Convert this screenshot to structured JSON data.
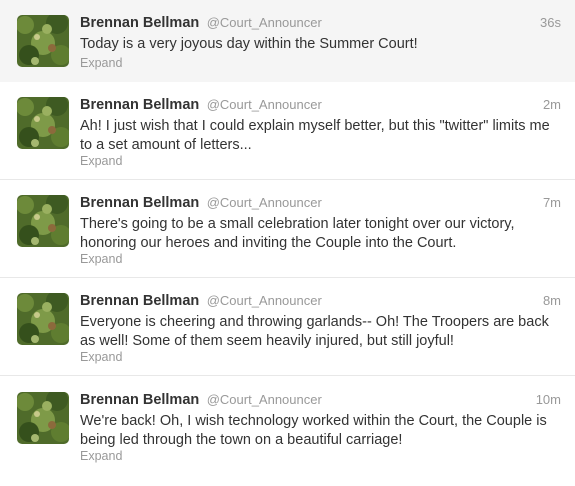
{
  "tweets": [
    {
      "fullname": "Brennan Bellman",
      "username": "@Court_Announcer",
      "time": "36s",
      "text": "Today is a very joyous day within the Summer Court!",
      "expand": "Expand"
    },
    {
      "fullname": "Brennan Bellman",
      "username": "@Court_Announcer",
      "time": "2m",
      "text": "Ah! I just wish that I could explain myself better, but this \"twitter\" limits me to a set amount of letters...",
      "expand": "Expand"
    },
    {
      "fullname": "Brennan Bellman",
      "username": "@Court_Announcer",
      "time": "7m",
      "text": "There's going to be a small celebration later tonight over our victory, honoring our heroes and inviting the Couple into the Court.",
      "expand": "Expand"
    },
    {
      "fullname": "Brennan Bellman",
      "username": "@Court_Announcer",
      "time": "8m",
      "text": "Everyone is cheering and throwing garlands-- Oh! The Troopers are back as well! Some of them seem heavily injured, but still joyful!",
      "expand": "Expand"
    },
    {
      "fullname": "Brennan Bellman",
      "username": "@Court_Announcer",
      "time": "10m",
      "text": "We're back! Oh, I wish technology worked within the Court, the Couple is being led through the town on a beautiful carriage!",
      "expand": "Expand"
    }
  ]
}
